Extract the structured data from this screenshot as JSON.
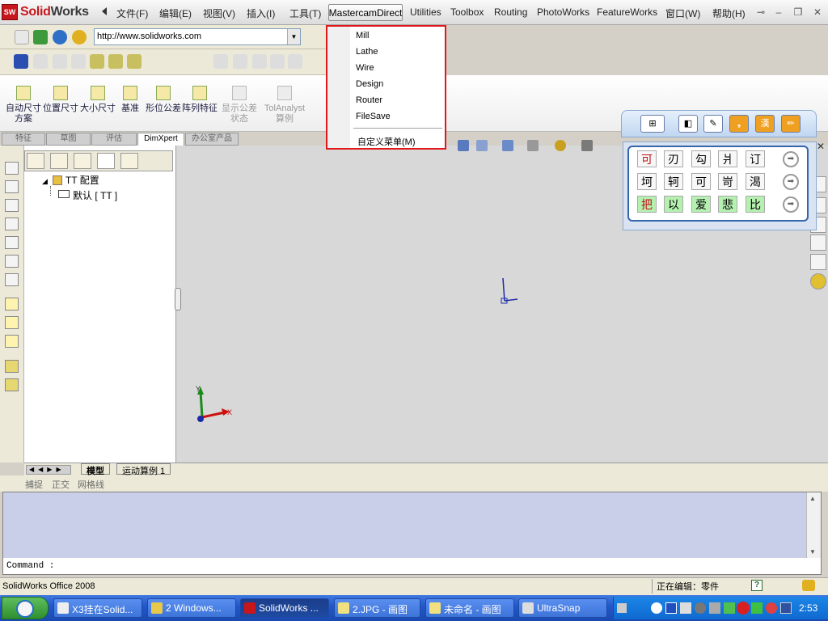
{
  "app": {
    "logo_prefix": "Solid",
    "logo_suffix": "Works"
  },
  "menubar": {
    "items": [
      "文件(F)",
      "编辑(E)",
      "视图(V)",
      "插入(I)",
      "工具(T)"
    ],
    "active": "MastercamDirect",
    "items_right": [
      "Utilities",
      "Toolbox",
      "Routing",
      "PhotoWorks",
      "FeatureWorks",
      "窗口(W)",
      "帮助(H)"
    ]
  },
  "url": {
    "value": "http://www.solidworks.com"
  },
  "command_manager": {
    "buttons": [
      {
        "label": "自动尺寸方案",
        "enabled": true
      },
      {
        "label": "位置尺寸",
        "enabled": true
      },
      {
        "label": "大小尺寸",
        "enabled": true
      },
      {
        "label": "基准",
        "enabled": true
      },
      {
        "label": "形位公差",
        "enabled": true
      },
      {
        "label": "阵列特征",
        "enabled": true
      },
      {
        "label": "显示公差状态",
        "enabled": false
      },
      {
        "label": "TolAnalyst算例",
        "enabled": false
      }
    ]
  },
  "tabs": {
    "items": [
      "特征",
      "草图",
      "评估",
      "DimXpert",
      "办公室产品"
    ],
    "active": "DimXpert"
  },
  "feature_tree": {
    "root": "TT 配置",
    "child": "默认 [ TT ]"
  },
  "dropdown": {
    "items": [
      "Mill",
      "Lathe",
      "Wire",
      "Design",
      "Router",
      "FileSave"
    ],
    "custom": "自定义菜单(M)"
  },
  "palette": {
    "top_buttons": [
      "⊞",
      "◧",
      "✎",
      "❟",
      "漢",
      "✏"
    ],
    "rows": [
      [
        "可",
        "刃",
        "勾",
        "爿",
        "订"
      ],
      [
        "坷",
        "轲",
        "可",
        "岢",
        "渴"
      ],
      [
        "把",
        "以",
        "爱",
        "悲",
        "比"
      ]
    ]
  },
  "model_tabs": {
    "items": [
      "模型",
      "运动算例 1"
    ],
    "active": "模型"
  },
  "snap_status": [
    "捕捉",
    "正交",
    "网格线"
  ],
  "command": {
    "prompt": "Command :"
  },
  "statusbar": {
    "left": "SolidWorks Office 2008",
    "editing": "正在编辑：零件"
  },
  "taskbar": {
    "tasks": [
      "X3挂在Solid...",
      "2 Windows...",
      "SolidWorks ...",
      "2.JPG - 画图",
      "未命名 - 画图",
      "UltraSnap"
    ],
    "active_index": 2,
    "clock": "2:53"
  },
  "axes": {
    "x": "X",
    "y": "Y"
  },
  "colors": {
    "accent_red": "#e0181c",
    "taskbar_blue": "#2458c8",
    "command_bg": "#c9cfe8"
  }
}
